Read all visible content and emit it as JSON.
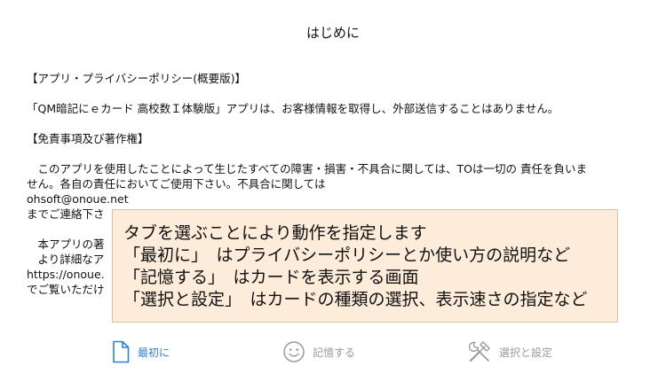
{
  "nav": {
    "title": "はじめに"
  },
  "content": {
    "privacy_heading": "【アプリ・プライバシーポリシー(概要版)】",
    "privacy_text": "「QM暗記にｅカード 高校数Ｉ体験版」アプリは、お客様情報を取得し、外部送信することはありません。",
    "disclaimer_heading": "【免責事項及び著作権】",
    "disclaimer_line1": "　このアプリを使用したことによって生じたすべての障害・損害・不具合に関しては、TOは一切の 責任を負いま",
    "disclaimer_line2": "せん。各自の責任においてご使用下さい。不具合に関しては",
    "email": " ohsoft@onoue.net",
    "contact_partial": "までご連絡下さ",
    "copyright_partial": "　本アプリの著",
    "details_partial": "　より詳細なア",
    "url_partial": "https://onoue.",
    "view_partial": "でご覧いただけ"
  },
  "overlay": {
    "line1": "タブを選ぶことにより動作を指定します",
    "line2": "「最初に」　はプライバシーポリシーとか使い方の説明など",
    "line3": "「記憶する」　はカードを表示する画面",
    "line4": "「選択と設定」　はカードの種類の選択、表示速さの指定など"
  },
  "tabs": [
    {
      "label": "最初に",
      "icon": "document-icon",
      "active": true
    },
    {
      "label": "記憶する",
      "icon": "smiley-icon",
      "active": false
    },
    {
      "label": "選択と設定",
      "icon": "tools-icon",
      "active": false
    }
  ],
  "colors": {
    "accent": "#2f7de1",
    "inactive": "#9a9a9a",
    "overlay_bg": "#fcecd9"
  }
}
